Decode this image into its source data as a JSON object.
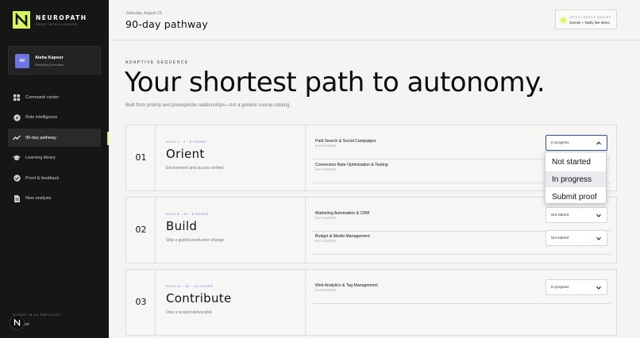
{
  "brand": {
    "name": "NEUROPATH",
    "tagline": "ROLE INTELLIGENCE"
  },
  "user": {
    "initials": "AK",
    "name": "Aisha Kapoor",
    "role": "Marketing Executive"
  },
  "nav": [
    {
      "label": "Command center",
      "icon": "grid-icon"
    },
    {
      "label": "Role intelligence",
      "icon": "compass-icon"
    },
    {
      "label": "90-day pathway",
      "icon": "trend-icon",
      "active": true
    },
    {
      "label": "Learning library",
      "icon": "graduation-cap-icon"
    },
    {
      "label": "Proof & feedback",
      "icon": "check-circle-icon"
    },
    {
      "label": "New analysis",
      "icon": "document-icon"
    }
  ],
  "footer": {
    "signed_in": "SIGNED IN AS EMPLOYEE",
    "logout": "Log out",
    "badge": "N"
  },
  "header": {
    "date": "Saturday, August 15",
    "title": "90-day pathway"
  },
  "engine": {
    "label": "INTELLIGENCE ENGINE",
    "value": "Gemini + Tavily live demo",
    "accent": "#dff56a"
  },
  "hero": {
    "eyebrow": "ADAPTIVE SEQUENCE",
    "title": "Your shortest path to autonomy.",
    "subtitle": "Built from priority and prerequisite relationships—not a generic course catalog."
  },
  "phases": [
    {
      "number": "01",
      "meta": "DAYS 1 - 7 · 6 HOURS",
      "name": "Orient",
      "desc": "Environment and access verified",
      "courses": [
        {
          "name": "Paid Search & Social Campaigns",
          "status": "IN PROGRESS",
          "select": "In progress"
        },
        {
          "name": "Conversion Rate Optimization & Testing",
          "status": "NOT STARTED",
          "select": "Not started"
        }
      ]
    },
    {
      "number": "02",
      "meta": "DAYS 8 - 30 · 8 HOURS",
      "name": "Build",
      "desc": "Ship a guided production change",
      "courses": [
        {
          "name": "Marketing Automation & CRM",
          "status": "NOT STARTED",
          "select": "Not started"
        },
        {
          "name": "Budget & Media Management",
          "status": "NOT STARTED",
          "select": "Not started"
        }
      ]
    },
    {
      "number": "03",
      "meta": "DAYS 31 - 60 · 12 HOURS",
      "name": "Contribute",
      "desc": "Own a scoped deliverable",
      "courses": [
        {
          "name": "Web Analytics & Tag Management",
          "status": "IN PROGRESS",
          "select": "In progress"
        }
      ]
    }
  ],
  "dropdown": {
    "options": [
      "Not started",
      "In progress",
      "Submit proof"
    ],
    "selected": "In progress"
  },
  "colors": {
    "accent": "#d8f564",
    "sidebar": "#161616",
    "meta": "#6d76e0",
    "focus": "#3a4bb8"
  }
}
